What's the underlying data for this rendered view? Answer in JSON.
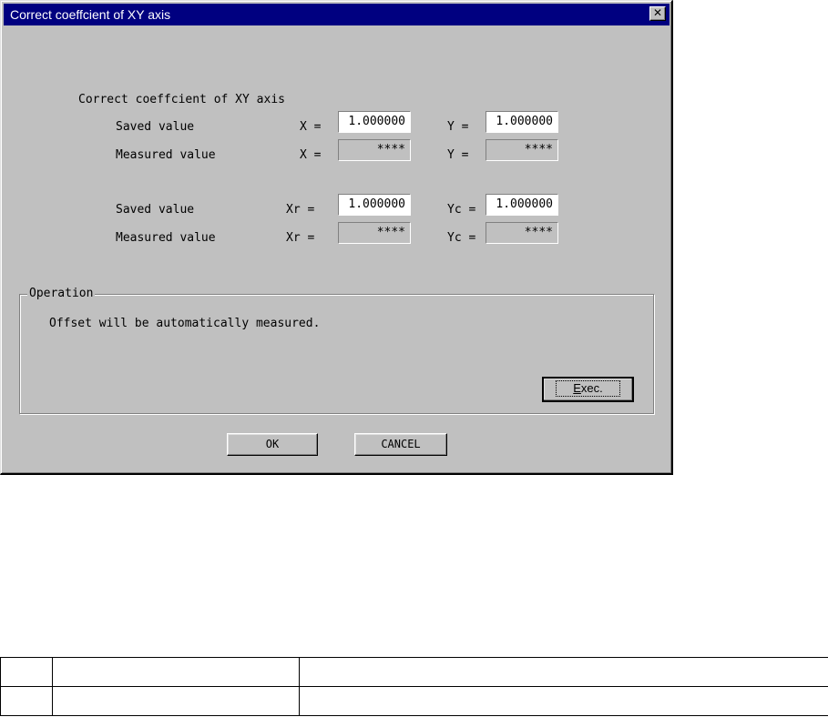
{
  "window": {
    "title": "Correct coeffcient of XY axis",
    "close_glyph": "✕"
  },
  "section": {
    "heading": "Correct coeffcient of XY axis"
  },
  "rows": [
    {
      "label": "Saved value",
      "left_label": "X =",
      "left_value": "1.000000",
      "right_label": "Y =",
      "right_value": "1.000000"
    },
    {
      "label": "Measured value",
      "left_label": "X =",
      "left_value": "****",
      "right_label": "Y =",
      "right_value": "****"
    },
    {
      "label": "Saved value",
      "left_label": "Xr =",
      "left_value": "1.000000",
      "right_label": "Yc =",
      "right_value": "1.000000"
    },
    {
      "label": "Measured value",
      "left_label": "Xr =",
      "left_value": "****",
      "right_label": "Yc =",
      "right_value": "****"
    }
  ],
  "operation": {
    "legend": "Operation",
    "message": "Offset will be automatically measured.",
    "exec_mnemonic": "E",
    "exec_rest": "xec."
  },
  "buttons": {
    "ok": "OK",
    "cancel": "CANCEL"
  },
  "colors": {
    "title_bar": "#000080",
    "dialog_face": "#c0c0c0"
  }
}
